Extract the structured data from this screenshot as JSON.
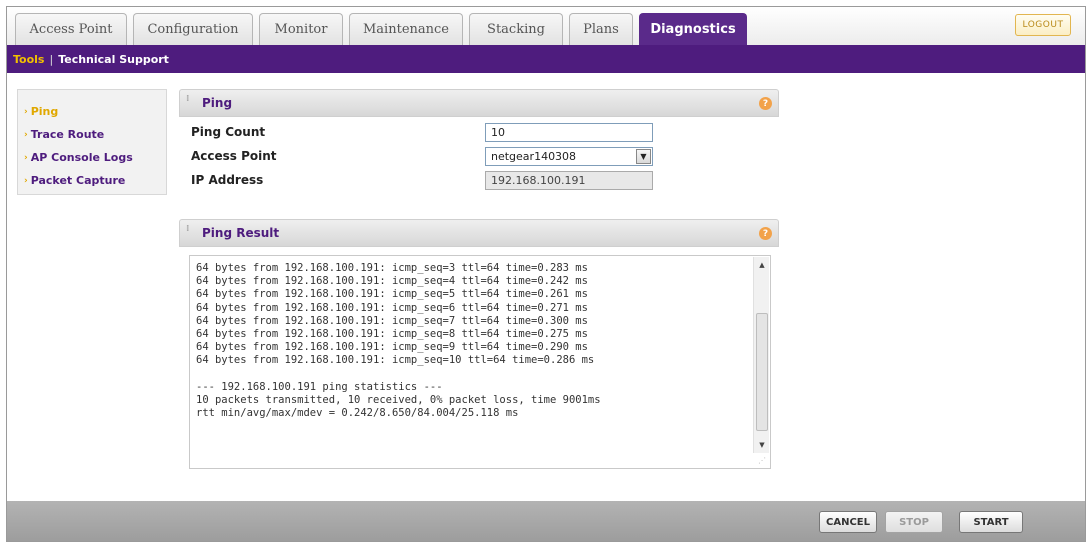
{
  "tabs": [
    {
      "label": "Access Point"
    },
    {
      "label": "Configuration"
    },
    {
      "label": "Monitor"
    },
    {
      "label": "Maintenance"
    },
    {
      "label": "Stacking"
    },
    {
      "label": "Plans"
    },
    {
      "label": "Diagnostics",
      "active": true
    }
  ],
  "logout_label": "LOGOUT",
  "subnav": {
    "tools": "Tools",
    "separator": "|",
    "tech_support": "Technical Support"
  },
  "leftmenu": {
    "items": [
      {
        "label": "Ping",
        "active": true
      },
      {
        "label": "Trace Route"
      },
      {
        "label": "AP Console Logs"
      },
      {
        "label": "Packet Capture"
      }
    ]
  },
  "ping_panel": {
    "title": "Ping",
    "ping_count_label": "Ping Count",
    "ping_count_value": "10",
    "access_point_label": "Access Point",
    "access_point_value": "netgear140308",
    "ip_label": "IP Address",
    "ip_value": "192.168.100.191"
  },
  "result_panel": {
    "title": "Ping Result",
    "text": "64 bytes from 192.168.100.191: icmp_seq=3 ttl=64 time=0.283 ms\n64 bytes from 192.168.100.191: icmp_seq=4 ttl=64 time=0.242 ms\n64 bytes from 192.168.100.191: icmp_seq=5 ttl=64 time=0.261 ms\n64 bytes from 192.168.100.191: icmp_seq=6 ttl=64 time=0.271 ms\n64 bytes from 192.168.100.191: icmp_seq=7 ttl=64 time=0.300 ms\n64 bytes from 192.168.100.191: icmp_seq=8 ttl=64 time=0.275 ms\n64 bytes from 192.168.100.191: icmp_seq=9 ttl=64 time=0.290 ms\n64 bytes from 192.168.100.191: icmp_seq=10 ttl=64 time=0.286 ms\n\n--- 192.168.100.191 ping statistics ---\n10 packets transmitted, 10 received, 0% packet loss, time 9001ms\nrtt min/avg/max/mdev = 0.242/8.650/84.004/25.118 ms"
  },
  "footer": {
    "cancel": "CANCEL",
    "stop": "STOP",
    "start": "START"
  },
  "colors": {
    "brand_purple": "#4e1c7e",
    "highlight_yellow": "#f2c100",
    "help_orange": "#f2a24a"
  },
  "icons": {
    "help": "help-icon",
    "dropdown": "chevron-down-icon",
    "scroll_up": "arrow-up-icon",
    "scroll_down": "arrow-down-icon"
  }
}
